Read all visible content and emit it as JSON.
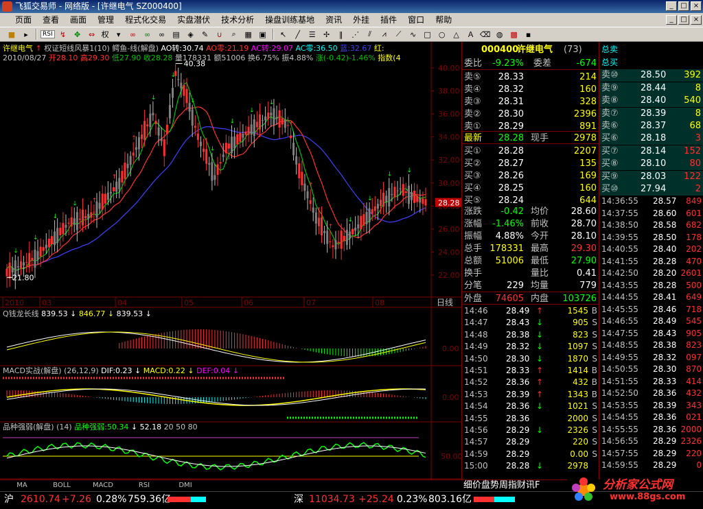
{
  "window": {
    "title": "飞狐交易师 - 网络版 - [许继电气 SZ000400]",
    "min": "_",
    "restore": "□",
    "close": "×"
  },
  "menu": [
    "页面",
    "查看",
    "画面",
    "管理",
    "程式化交易",
    "实盘潜伏",
    "技术分析",
    "操盘训练基地",
    "资讯",
    "外挂",
    "插件",
    "窗口",
    "帮助"
  ],
  "toolbar": {
    "rsi": "RSI",
    "quan": "权"
  },
  "header": {
    "line1": {
      "stock": "许继电气",
      "formula": "权证短线风暴1(10)",
      "fish": "鳄鱼-线(解盘)",
      "ao": "AO转:30.74",
      "aozero": "AO零:21.19",
      "ac": "AC转:29.07",
      "acz": "AC零:36.50",
      "blue": "蓝:32.67",
      "red": "红:"
    },
    "line2": {
      "date": "2010/08/27",
      "open": "开28.10",
      "high": "高29.30",
      "low": "低27.90",
      "close": "收28.28",
      "vol": "量178331",
      "amt": "额51006",
      "turn": "换6.75%",
      "amp": "振4.88%",
      "chg": "涨(-0.42)-1.46%",
      "idx": "指数(4"
    }
  },
  "price_axis": [
    "40.00",
    "38.00",
    "36.00",
    "34.00",
    "32.00",
    "30.00",
    "28.00",
    "26.00",
    "24.00",
    "22.00"
  ],
  "annotations": {
    "high_label": "40.38",
    "low_label": "21.80",
    "last_price": "28.28"
  },
  "date_axis": [
    "2010",
    "03",
    "04",
    "05",
    "06",
    "07",
    "08"
  ],
  "period": "日线",
  "indicator1": {
    "title": "Q钱龙长线",
    "v1": "839.53",
    "v2": "846.77",
    "v3": "839.53",
    "axis0": "0.00"
  },
  "indicator2": {
    "title": "MACD实战(解盘)",
    "params": "(26,12,9)",
    "dif": "DIF:0.23",
    "macd": "MACD:0.22",
    "def": "DEF:0.04",
    "axis0": "0.00"
  },
  "indicator3": {
    "title": "品种强弱(解盘)",
    "params": "(14)",
    "label": "品种强弱:50.34",
    "v2": "52.18",
    "v3": "20",
    "v4": "50",
    "v5": "80",
    "axis50": "50.00"
  },
  "tabs": [
    "MA",
    "BOLL",
    "MACD",
    "RSI",
    "DMI"
  ],
  "quote": {
    "code": "000400",
    "name": "许继电气",
    "seq": "(73)",
    "weibi_label": "委比",
    "weibi": "-9.23%",
    "weicha_label": "委差",
    "weicha": "-674",
    "sells": [
      {
        "label": "卖⑤",
        "price": "28.33",
        "vol": "214"
      },
      {
        "label": "卖④",
        "price": "28.32",
        "vol": "160"
      },
      {
        "label": "卖③",
        "price": "28.31",
        "vol": "328"
      },
      {
        "label": "卖②",
        "price": "28.30",
        "vol": "2396"
      },
      {
        "label": "卖①",
        "price": "28.29",
        "vol": "891"
      }
    ],
    "last_label": "最新",
    "last": "28.28",
    "xianshou_label": "现手",
    "xianshou": "2978",
    "buys": [
      {
        "label": "买①",
        "price": "28.28",
        "vol": "2207"
      },
      {
        "label": "买②",
        "price": "28.27",
        "vol": "135"
      },
      {
        "label": "买③",
        "price": "28.26",
        "vol": "169"
      },
      {
        "label": "买④",
        "price": "28.25",
        "vol": "160"
      },
      {
        "label": "买⑤",
        "price": "28.24",
        "vol": "644"
      }
    ],
    "stats": [
      {
        "l1": "涨跌",
        "v1": "-0.42",
        "l2": "均价",
        "v2": "28.60"
      },
      {
        "l1": "涨幅",
        "v1": "-1.46%",
        "l2": "前收",
        "v2": "28.70"
      },
      {
        "l1": "振幅",
        "v1": "4.88%",
        "l2": "今开",
        "v2": "28.10"
      },
      {
        "l1": "总手",
        "v1": "178331",
        "l2": "最高",
        "v2": "29.30"
      },
      {
        "l1": "总额",
        "v1": "51006",
        "l2": "最低",
        "v2": "27.90"
      },
      {
        "l1": "换手",
        "v1": "",
        "l2": "量比",
        "v2": "0.41"
      },
      {
        "l1": "分笔",
        "v1": "229",
        "l2": "均量",
        "v2": "779"
      }
    ],
    "waipan_label": "外盘",
    "waipan": "74605",
    "neipan_label": "内盘",
    "neipan": "103726",
    "ticks": [
      {
        "t": "14:46",
        "p": "28.49",
        "d": "↑",
        "v": "1545",
        "s": "B"
      },
      {
        "t": "14:47",
        "p": "28.43",
        "d": "↓",
        "v": "905",
        "s": "S"
      },
      {
        "t": "14:48",
        "p": "28.38",
        "d": "↓",
        "v": "823",
        "s": "S"
      },
      {
        "t": "14:49",
        "p": "28.32",
        "d": "↓",
        "v": "1097",
        "s": "S"
      },
      {
        "t": "14:50",
        "p": "28.30",
        "d": "↓",
        "v": "1870",
        "s": "S"
      },
      {
        "t": "14:51",
        "p": "28.33",
        "d": "↑",
        "v": "1414",
        "s": "B"
      },
      {
        "t": "14:52",
        "p": "28.36",
        "d": "↑",
        "v": "432",
        "s": "B"
      },
      {
        "t": "14:53",
        "p": "28.39",
        "d": "↑",
        "v": "1343",
        "s": "B"
      },
      {
        "t": "14:54",
        "p": "28.36",
        "d": "↓",
        "v": "1021",
        "s": "S"
      },
      {
        "t": "14:55",
        "p": "28.36",
        "d": "",
        "v": "2000",
        "s": "S"
      },
      {
        "t": "14:56",
        "p": "28.29",
        "d": "↓",
        "v": "2326",
        "s": "S"
      },
      {
        "t": "14:57",
        "p": "28.29",
        "d": "",
        "v": "220",
        "s": "S"
      },
      {
        "t": "14:59",
        "p": "28.29",
        "d": "",
        "v": "0.00",
        "s": "S"
      },
      {
        "t": "15:00",
        "p": "28.28",
        "d": "↓",
        "v": "2978",
        "s": ""
      }
    ],
    "bottom_tabs": "细价盘势周指财讯F"
  },
  "side": {
    "zongmai": "总卖",
    "zongmai2": "总买",
    "sells": [
      {
        "label": "卖⑩",
        "price": "28.50",
        "vol": "392"
      },
      {
        "label": "卖⑨",
        "price": "28.44",
        "vol": "8"
      },
      {
        "label": "卖⑧",
        "price": "28.40",
        "vol": "540"
      },
      {
        "label": "卖⑦",
        "price": "28.39",
        "vol": "8"
      },
      {
        "label": "卖⑥",
        "price": "28.37",
        "vol": "68"
      }
    ],
    "buys": [
      {
        "label": "买⑥",
        "price": "28.18",
        "vol": "3"
      },
      {
        "label": "买⑦",
        "price": "28.14",
        "vol": "152"
      },
      {
        "label": "买⑧",
        "price": "28.10",
        "vol": "80"
      },
      {
        "label": "买⑨",
        "price": "28.03",
        "vol": "122"
      },
      {
        "label": "买⑩",
        "price": "27.94",
        "vol": "2"
      }
    ],
    "ticks": [
      {
        "t": "14:36:55",
        "p": "28.57",
        "v": "849"
      },
      {
        "t": "14:37:55",
        "p": "28.60",
        "v": "601"
      },
      {
        "t": "14:38:50",
        "p": "28.58",
        "v": "682"
      },
      {
        "t": "14:39:55",
        "p": "28.50",
        "v": "178"
      },
      {
        "t": "14:40:55",
        "p": "28.40",
        "v": "202"
      },
      {
        "t": "14:41:55",
        "p": "28.28",
        "v": "470"
      },
      {
        "t": "14:42:50",
        "p": "28.20",
        "v": "2601"
      },
      {
        "t": "14:43:55",
        "p": "28.28",
        "v": "500"
      },
      {
        "t": "14:44:55",
        "p": "28.41",
        "v": "649"
      },
      {
        "t": "14:45:55",
        "p": "28.46",
        "v": "718"
      },
      {
        "t": "14:46:55",
        "p": "28.49",
        "v": "545"
      },
      {
        "t": "14:47:55",
        "p": "28.43",
        "v": "905"
      },
      {
        "t": "14:48:55",
        "p": "28.38",
        "v": "823"
      },
      {
        "t": "14:49:55",
        "p": "28.32",
        "v": "097"
      },
      {
        "t": "14:50:55",
        "p": "28.30",
        "v": "870"
      },
      {
        "t": "14:51:55",
        "p": "28.33",
        "v": "414"
      },
      {
        "t": "14:52:50",
        "p": "28.36",
        "v": "432"
      },
      {
        "t": "14:53:55",
        "p": "28.39",
        "v": "343"
      },
      {
        "t": "14:54:55",
        "p": "28.36",
        "v": "021"
      },
      {
        "t": "14:55:55",
        "p": "28.36",
        "v": "2000"
      },
      {
        "t": "14:56:55",
        "p": "28.29",
        "v": "2326"
      },
      {
        "t": "14:57:55",
        "p": "28.29",
        "v": "220"
      },
      {
        "t": "14:59:55",
        "p": "28.29",
        "v": "0"
      }
    ]
  },
  "status": {
    "sh_label": "沪",
    "sh_idx": "2610.74",
    "sh_chg": "+7.26",
    "sh_pct": "0.28%",
    "sh_amt": "759.36亿",
    "sz_label": "深",
    "sz_idx": "11034.73",
    "sz_chg": "+25.24",
    "sz_pct": "0.23%",
    "sz_amt": "803.16亿"
  },
  "logo": {
    "text": "分析家公式网",
    "url": "www.88gs.com"
  },
  "chart_data": {
    "type": "candlestick",
    "price_range": [
      21.8,
      40.38
    ],
    "ma_lines": [
      "green",
      "red",
      "blue"
    ],
    "indicator_q": "Q钱龙长线",
    "indicator_macd": "MACD实战(解盘)",
    "indicator_strength": "品种强弱(解盘)"
  },
  "colors": {
    "red": "#ff3030",
    "green": "#00c000",
    "yellow": "#ffff00",
    "cyan": "#00ffff",
    "axis": "#800000",
    "text": "#c0c0c0",
    "white": "#ffffff",
    "magenta": "#ff00ff",
    "blue": "#4040ff"
  }
}
